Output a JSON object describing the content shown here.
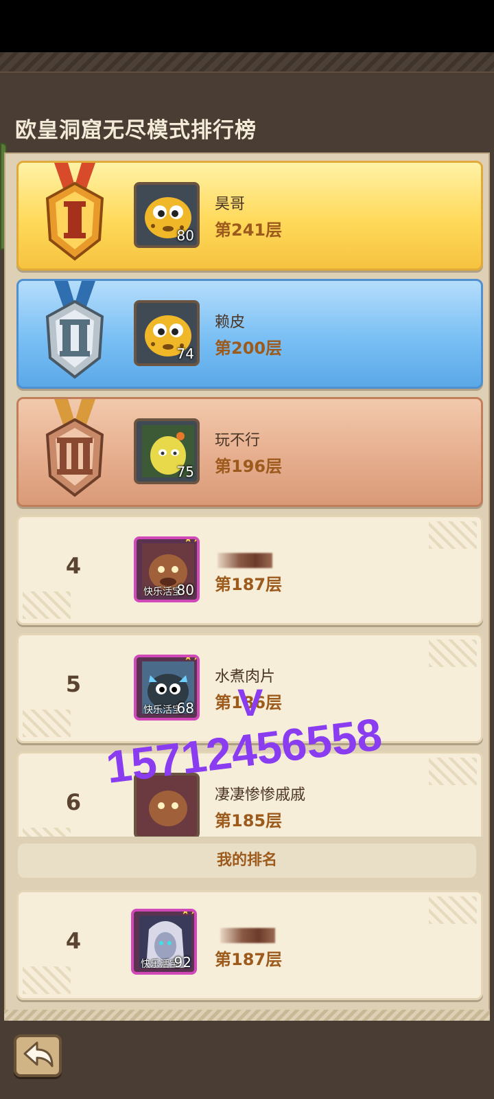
{
  "page": {
    "title": "欧皇洞窟无尽模式排行榜",
    "my_rank_label": "我的排名"
  },
  "rankings": [
    {
      "rank": "1",
      "name": "昊哥",
      "level": "80",
      "floor": "第241层",
      "tier": "gold"
    },
    {
      "rank": "2",
      "name": "赖皮",
      "level": "74",
      "floor": "第200层",
      "tier": "silver"
    },
    {
      "rank": "3",
      "name": "玩不行",
      "level": "75",
      "floor": "第196层",
      "tier": "bronze"
    },
    {
      "rank": "4",
      "name": "",
      "level": "80",
      "floor": "第187层",
      "tag": "快乐活宝"
    },
    {
      "rank": "5",
      "name": "水煮肉片",
      "level": "68",
      "floor": "第186层",
      "tag": "快乐活宝"
    },
    {
      "rank": "6",
      "name": "凄凄惨惨戚戚",
      "level": "",
      "floor": "第185层"
    }
  ],
  "my_rank": {
    "rank": "4",
    "name": "",
    "level": "92",
    "floor": "第187层",
    "tag": "快乐活宝"
  },
  "watermark": {
    "letter": "V",
    "number": "15712456558"
  },
  "icons": {
    "back": "back-arrow-icon"
  },
  "colors": {
    "gold": "#ffd95a",
    "silver": "#79bff4",
    "bronze": "#e6ae8e",
    "floor_text": "#9c5a1c"
  }
}
